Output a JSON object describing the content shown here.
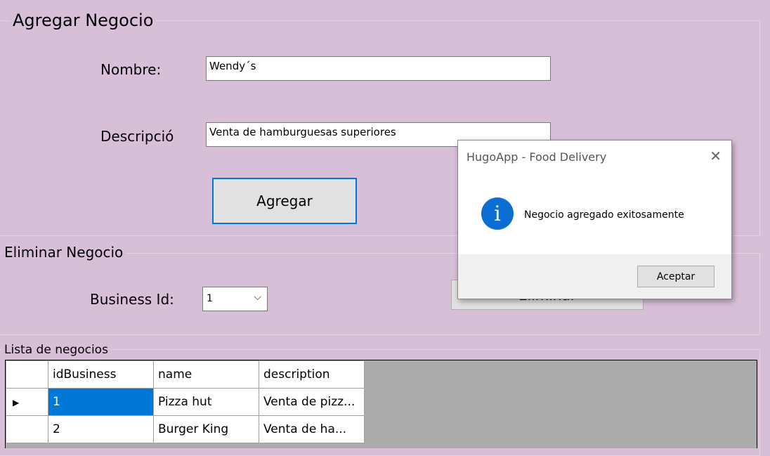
{
  "agregar": {
    "title": "Agregar Negocio",
    "nombre_label": "Nombre:",
    "nombre_value": "Wendy´s",
    "descripcion_label": "Descripció",
    "descripcion_value": "Venta de hamburguesas superiores",
    "button": "Agregar"
  },
  "eliminar": {
    "title": "Eliminar Negocio",
    "business_id_label": "Business Id:",
    "business_id_value": "1",
    "button": "Eliminar"
  },
  "lista": {
    "title": "Lista de negocios",
    "columns": [
      "idBusiness",
      "name",
      "description"
    ],
    "rows": [
      {
        "idBusiness": "1",
        "name": "Pizza hut",
        "description": "Venta de pizz..."
      },
      {
        "idBusiness": "2",
        "name": "Burger King",
        "description": "Venta de ha..."
      }
    ]
  },
  "dialog": {
    "title": "HugoApp - Food Delivery",
    "icon": "info-icon",
    "message": "Negocio agregado exitosamente",
    "ok": "Aceptar"
  }
}
